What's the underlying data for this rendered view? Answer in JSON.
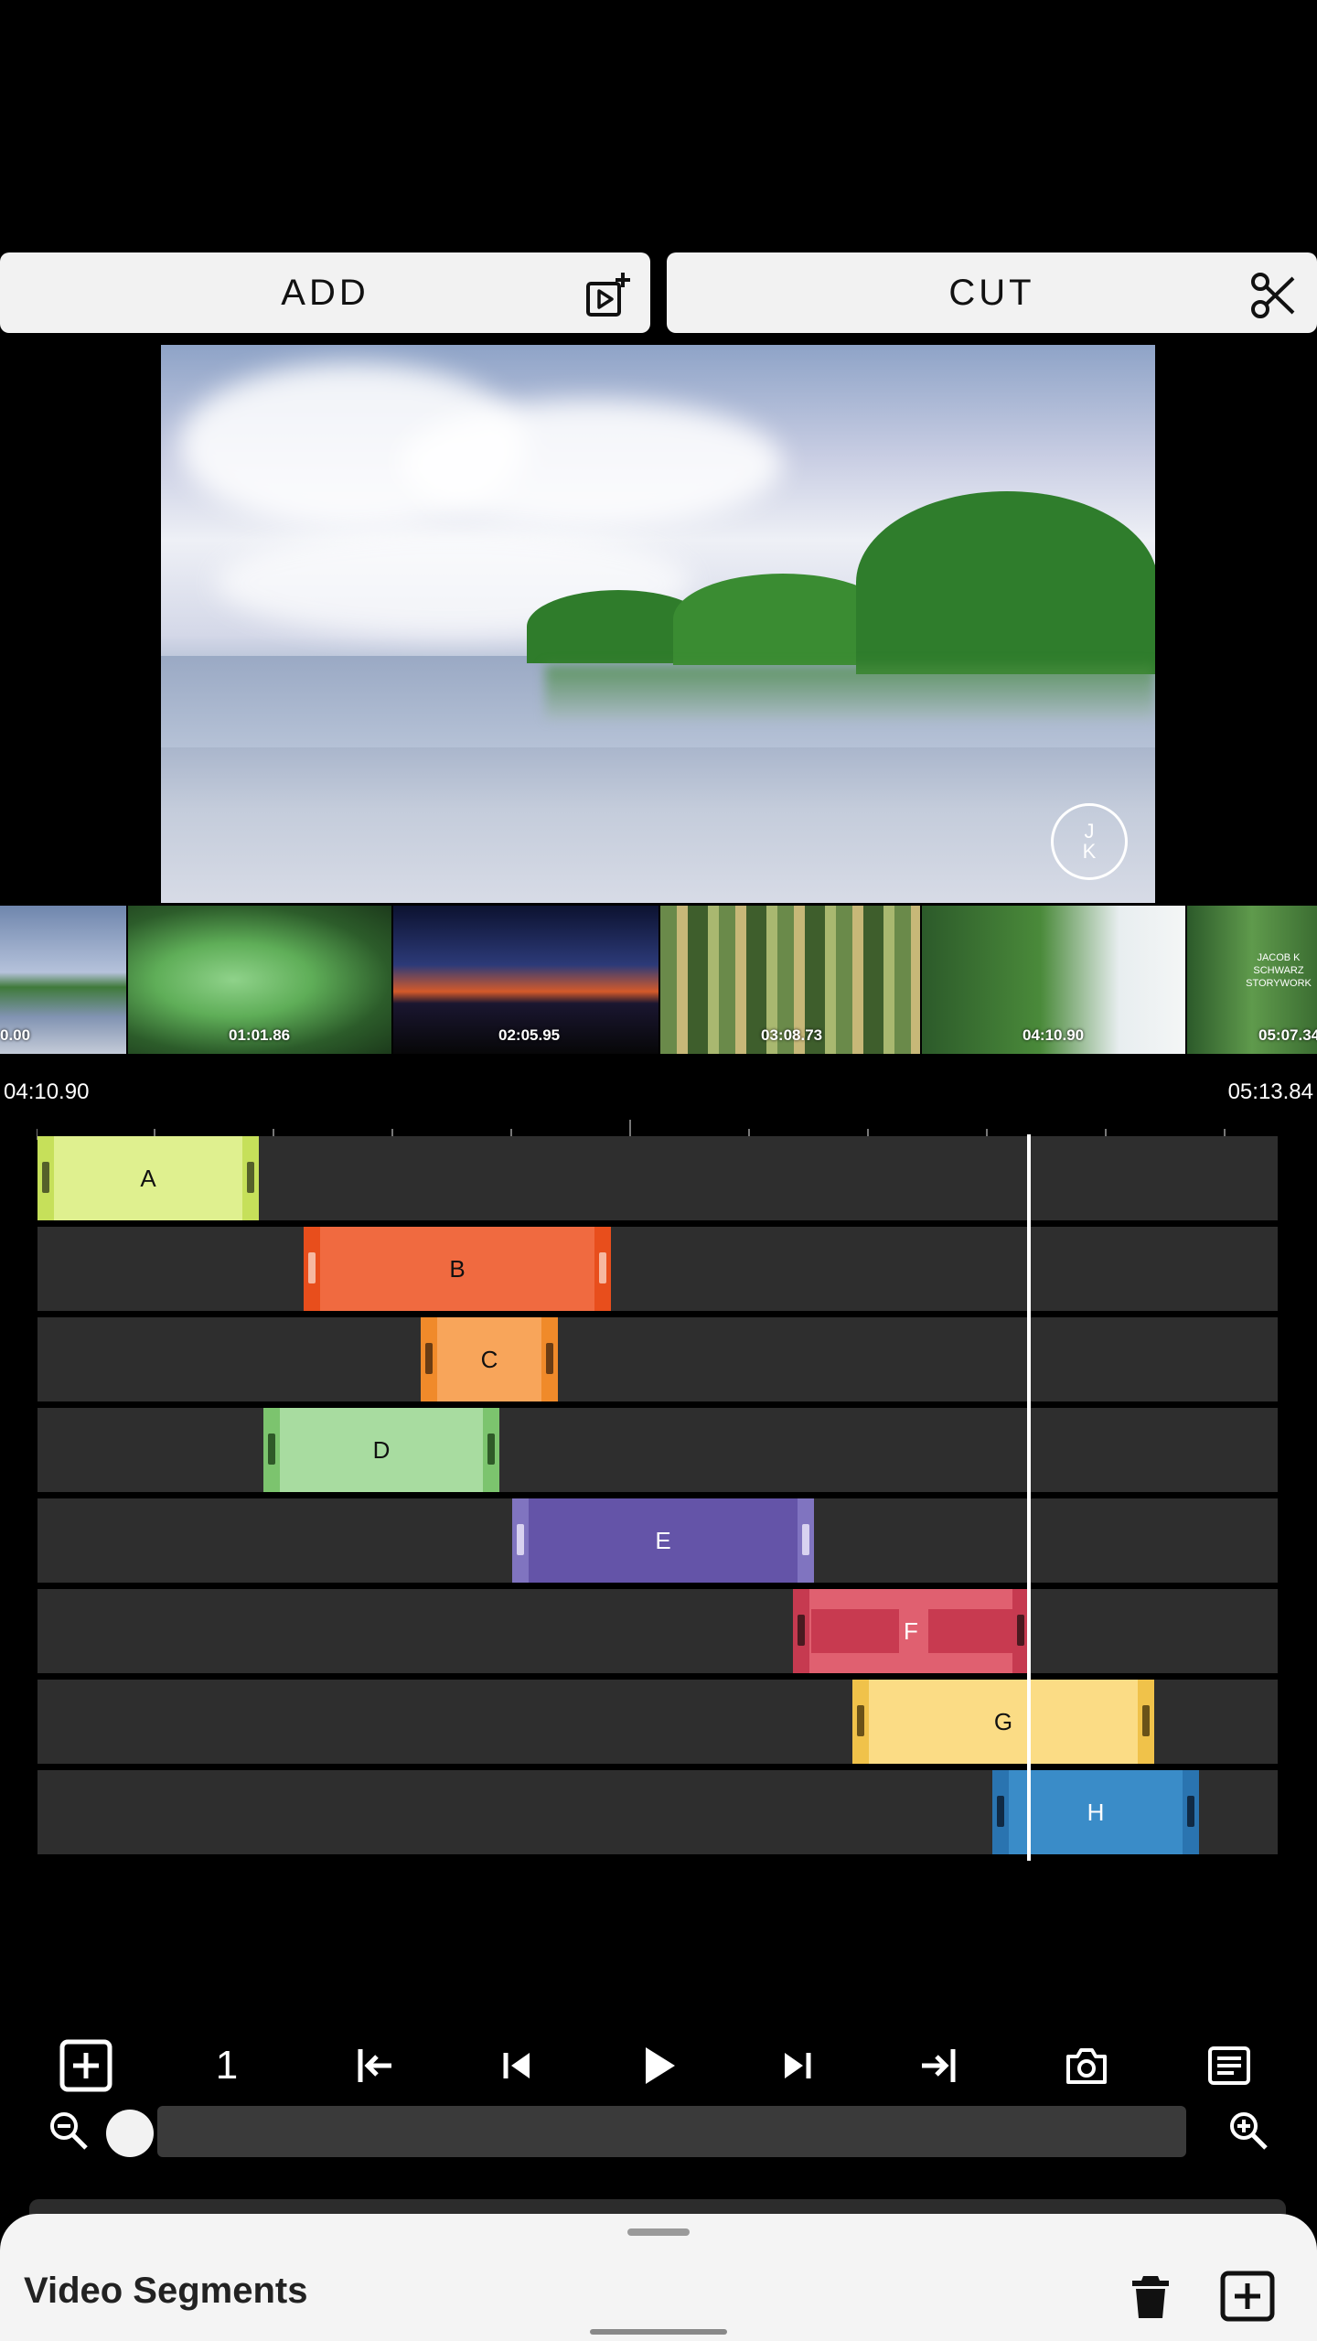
{
  "toolbar": {
    "add_label": "ADD",
    "add_icon": "add-video-icon",
    "cut_label": "CUT",
    "cut_icon": "scissors-icon"
  },
  "preview": {
    "logo_line1": "J",
    "logo_line2": "K"
  },
  "thumbnails": [
    {
      "time": "0.00"
    },
    {
      "time": "01:01.86"
    },
    {
      "time": "02:05.95"
    },
    {
      "time": "03:08.73"
    },
    {
      "time": "04:10.90"
    },
    {
      "time": "05:07.34",
      "overlay_text": "JACOB K SCHWARZ STORYWORK"
    }
  ],
  "timeline": {
    "visible_start": "04:10.90",
    "visible_end": "05:13.84",
    "tracks": [
      {
        "label": "A",
        "color": "#dff08f",
        "handle": "#c6e05a"
      },
      {
        "label": "B",
        "color": "#f06a40",
        "handle": "#e84e1c"
      },
      {
        "label": "C",
        "color": "#f8a55a",
        "handle": "#f08a2a"
      },
      {
        "label": "D",
        "color": "#a8dca0",
        "handle": "#7cc46e"
      },
      {
        "label": "E",
        "color": "#6454a8",
        "handle": "#8074c0"
      },
      {
        "label": "F",
        "color": "#dd5b6d",
        "handle": "#c63a50"
      },
      {
        "label": "G",
        "color": "#fbdc85",
        "handle": "#f0c24a"
      },
      {
        "label": "H",
        "color": "#3a8cc8",
        "handle": "#2a74b0"
      }
    ]
  },
  "transport": {
    "frame_step_value": "1",
    "icons": [
      "add-box-icon",
      "jump-start-icon",
      "skip-previous-icon",
      "play-icon",
      "skip-next-icon",
      "jump-end-icon",
      "camera-icon",
      "notes-icon"
    ]
  },
  "zoom": {
    "out_icon": "zoom-out-icon",
    "in_icon": "zoom-in-icon",
    "level": 0.0
  },
  "sheet": {
    "title": "Video Segments",
    "delete_icon": "trash-icon",
    "add_icon": "add-box-icon"
  }
}
